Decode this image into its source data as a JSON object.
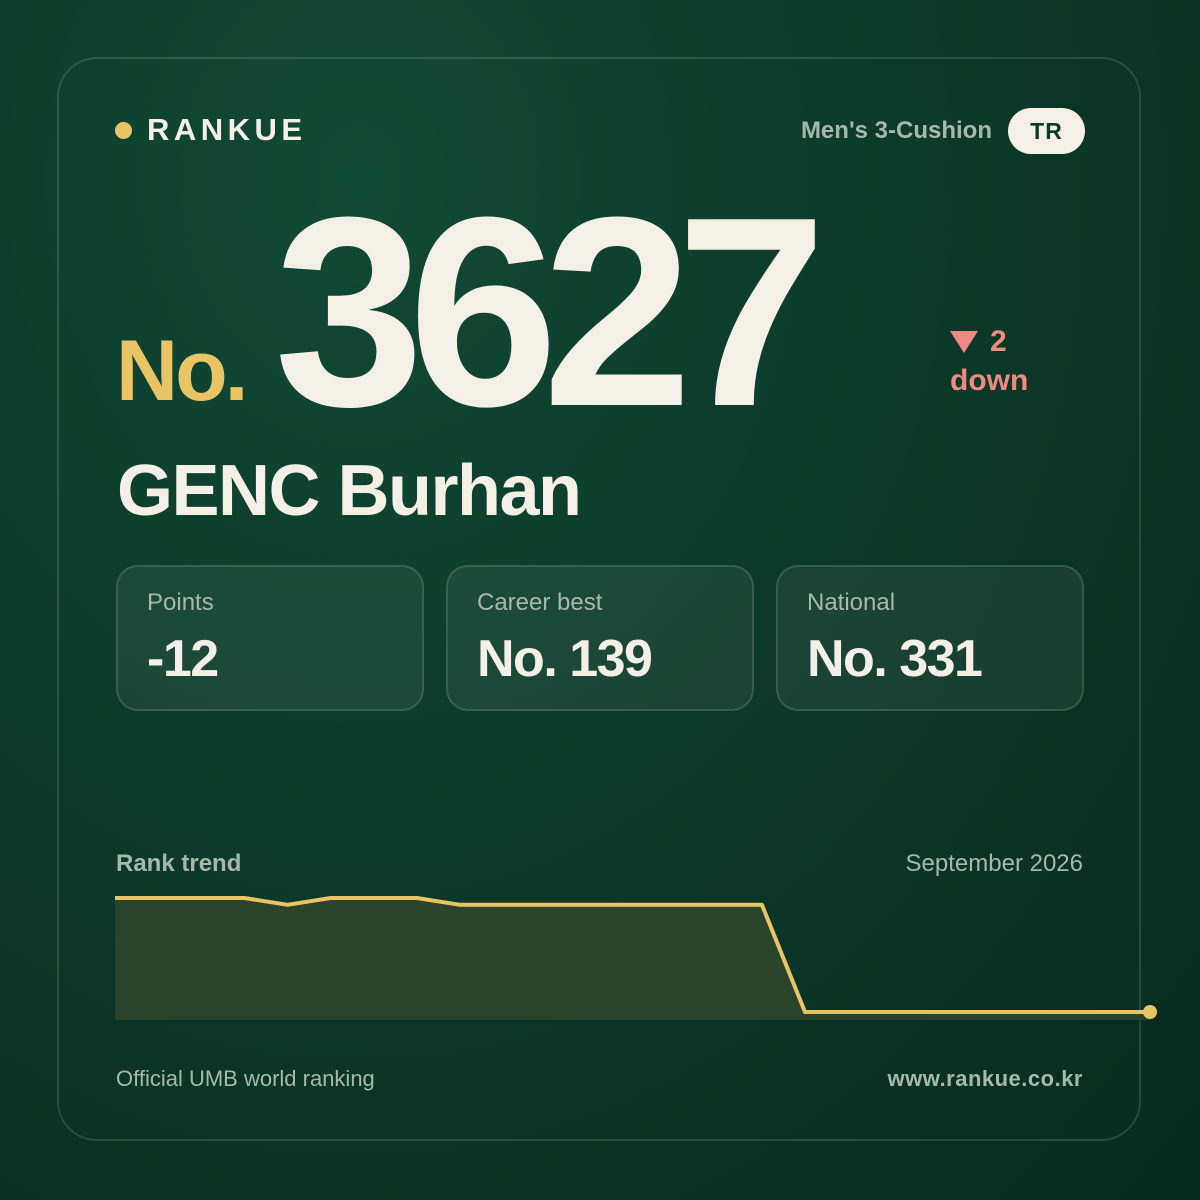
{
  "header": {
    "brand": "RANKUE",
    "category": "Men's 3-Cushion",
    "country_code": "TR"
  },
  "rank": {
    "prefix": "No.",
    "number": "3627",
    "change_amount": "2",
    "change_word": "down",
    "change_direction": "down"
  },
  "player": {
    "name": "GENC Burhan"
  },
  "stats": [
    {
      "label": "Points",
      "value": "-12"
    },
    {
      "label": "Career best",
      "value": "No. 139"
    },
    {
      "label": "National",
      "value": "No. 331"
    }
  ],
  "trend": {
    "label": "Rank trend",
    "date": "September 2026"
  },
  "chart_data": {
    "type": "area",
    "y_inverted": true,
    "values": [
      0,
      0,
      0,
      0,
      0.06,
      0,
      0,
      0,
      0.06,
      0.06,
      0.06,
      0.06,
      0.06,
      0.06,
      0.06,
      0.06,
      1.0,
      1.0,
      1.0,
      1.0,
      1.0,
      1.0,
      1.0,
      1.0,
      1.0
    ],
    "colors": {
      "line": "#e8c465",
      "fill": "#2c432b"
    }
  },
  "footer": {
    "source": "Official UMB world ranking",
    "website": "www.rankue.co.kr"
  },
  "colors": {
    "background": "#0c3a2a",
    "accent": "#e8c465",
    "down": "#ee8a80",
    "text": "#f5f0e6",
    "muted": "#a7b8aa"
  }
}
